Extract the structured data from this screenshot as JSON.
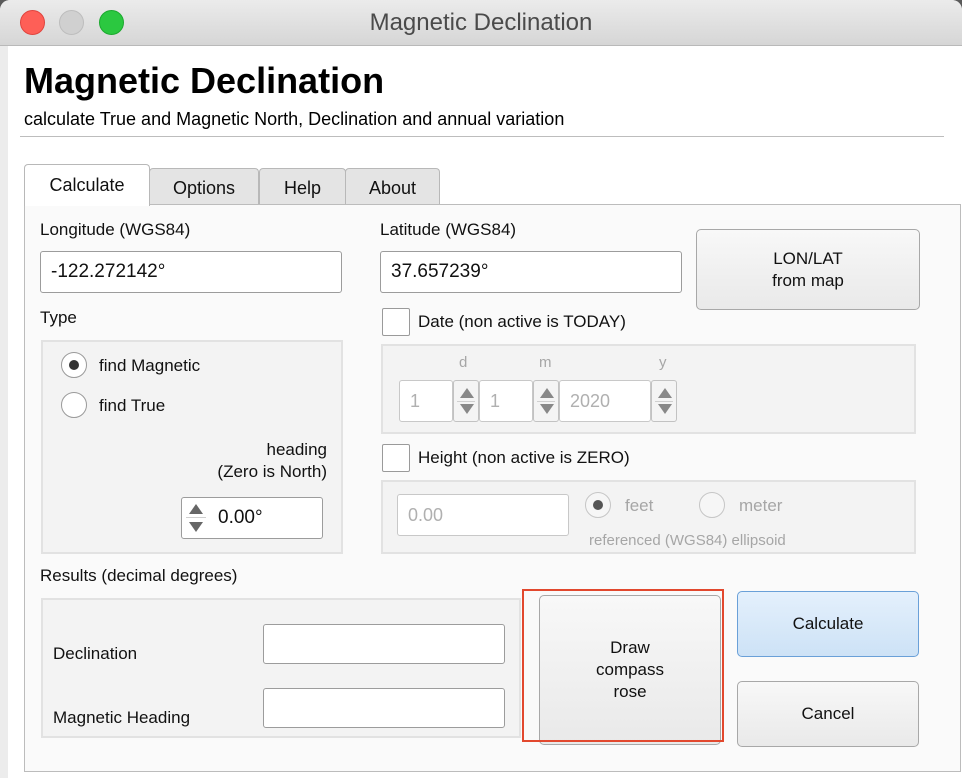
{
  "window": {
    "title": "Magnetic Declination"
  },
  "header": {
    "title": "Magnetic Declination",
    "subtitle": "calculate True and Magnetic North, Declination and annual variation"
  },
  "tabs": [
    {
      "label": "Calculate",
      "active": true
    },
    {
      "label": "Options",
      "active": false
    },
    {
      "label": "Help",
      "active": false
    },
    {
      "label": "About",
      "active": false
    }
  ],
  "coords": {
    "longitude_label": "Longitude (WGS84)",
    "longitude_value": "-122.272142°",
    "latitude_label": "Latitude (WGS84)",
    "latitude_value": "37.657239°",
    "from_map_line1": "LON/LAT",
    "from_map_line2": "from map"
  },
  "type": {
    "label": "Type",
    "option_magnetic": "find Magnetic",
    "option_true": "find True",
    "selected": "find Magnetic",
    "heading_line1": "heading",
    "heading_line2": "(Zero is North)",
    "heading_value": "0.00°"
  },
  "date": {
    "checkbox_label": "Date (non active is TODAY)",
    "checked": false,
    "d_label": "d",
    "m_label": "m",
    "y_label": "y",
    "day": "1",
    "month": "1",
    "year": "2020"
  },
  "height": {
    "checkbox_label": "Height (non active is ZERO)",
    "checked": false,
    "value": "0.00",
    "unit_feet": "feet",
    "unit_meter": "meter",
    "selected_unit": "feet",
    "note": "referenced (WGS84) ellipsoid"
  },
  "results": {
    "label": "Results (decimal degrees)",
    "declination_label": "Declination",
    "declination_value": "",
    "magnetic_heading_label": "Magnetic Heading",
    "magnetic_heading_value": ""
  },
  "actions": {
    "draw_line1": "Draw",
    "draw_line2": "compass",
    "draw_line3": "rose",
    "calculate": "Calculate",
    "cancel": "Cancel"
  },
  "colors": {
    "highlight": "#e2482e",
    "primary_border": "#6aa0d8"
  }
}
